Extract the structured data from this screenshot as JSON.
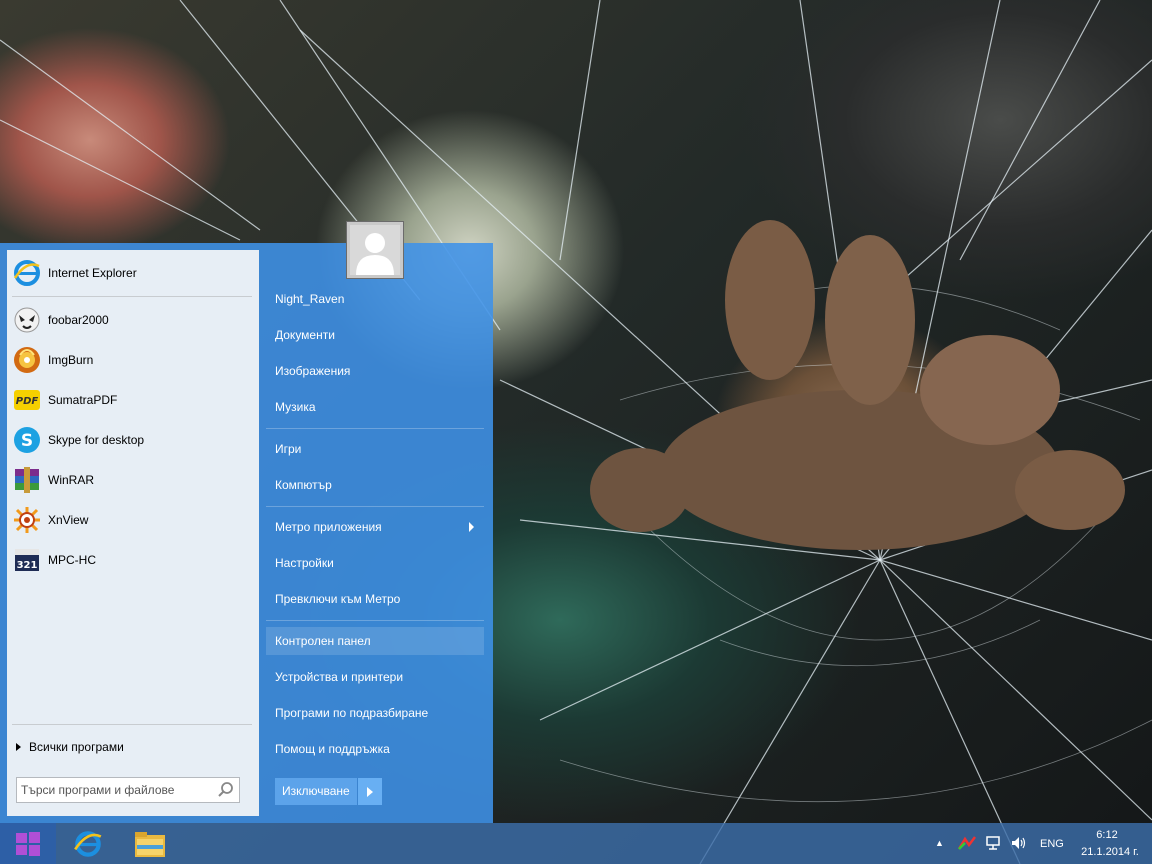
{
  "start_menu": {
    "pinned_programs": [
      {
        "label": "Internet Explorer",
        "icon": "internet-explorer-icon"
      }
    ],
    "recent_programs": [
      {
        "label": "foobar2000",
        "icon": "foobar2000-icon"
      },
      {
        "label": "ImgBurn",
        "icon": "imgburn-icon"
      },
      {
        "label": "SumatraPDF",
        "icon": "sumatrapdf-icon"
      },
      {
        "label": "Skype for desktop",
        "icon": "skype-icon"
      },
      {
        "label": "WinRAR",
        "icon": "winrar-icon"
      },
      {
        "label": "XnView",
        "icon": "xnview-icon"
      },
      {
        "label": "MPC-HC",
        "icon": "mpc-hc-icon"
      }
    ],
    "all_programs_label": "Всички програми",
    "search": {
      "placeholder": "Търси програми и файлове",
      "value": ""
    },
    "user_name": "Night_Raven",
    "right_items": [
      "Night_Raven",
      "Документи",
      "Изображения",
      "Музика",
      "Игри",
      "Компютър",
      "Метро приложения",
      "Настройки",
      "Превключи към Метро",
      "Контролен панел",
      "Устройства и принтери",
      "Програми по подразбиране",
      "Помощ и поддръжка"
    ],
    "shutdown_label": "Изключване"
  },
  "taskbar": {
    "apps": [
      {
        "name": "internet-explorer",
        "icon": "internet-explorer-icon"
      },
      {
        "name": "file-explorer",
        "icon": "folder-icon"
      }
    ],
    "tray": {
      "language": "ENG",
      "time": "6:12",
      "date": "21.1.2014 г."
    }
  },
  "colors": {
    "start_menu_bg": "#3f92e8",
    "taskbar_bg": "#3c6eaa",
    "start_button": "#2d5fa6",
    "windows_logo": "#b04fd6"
  }
}
